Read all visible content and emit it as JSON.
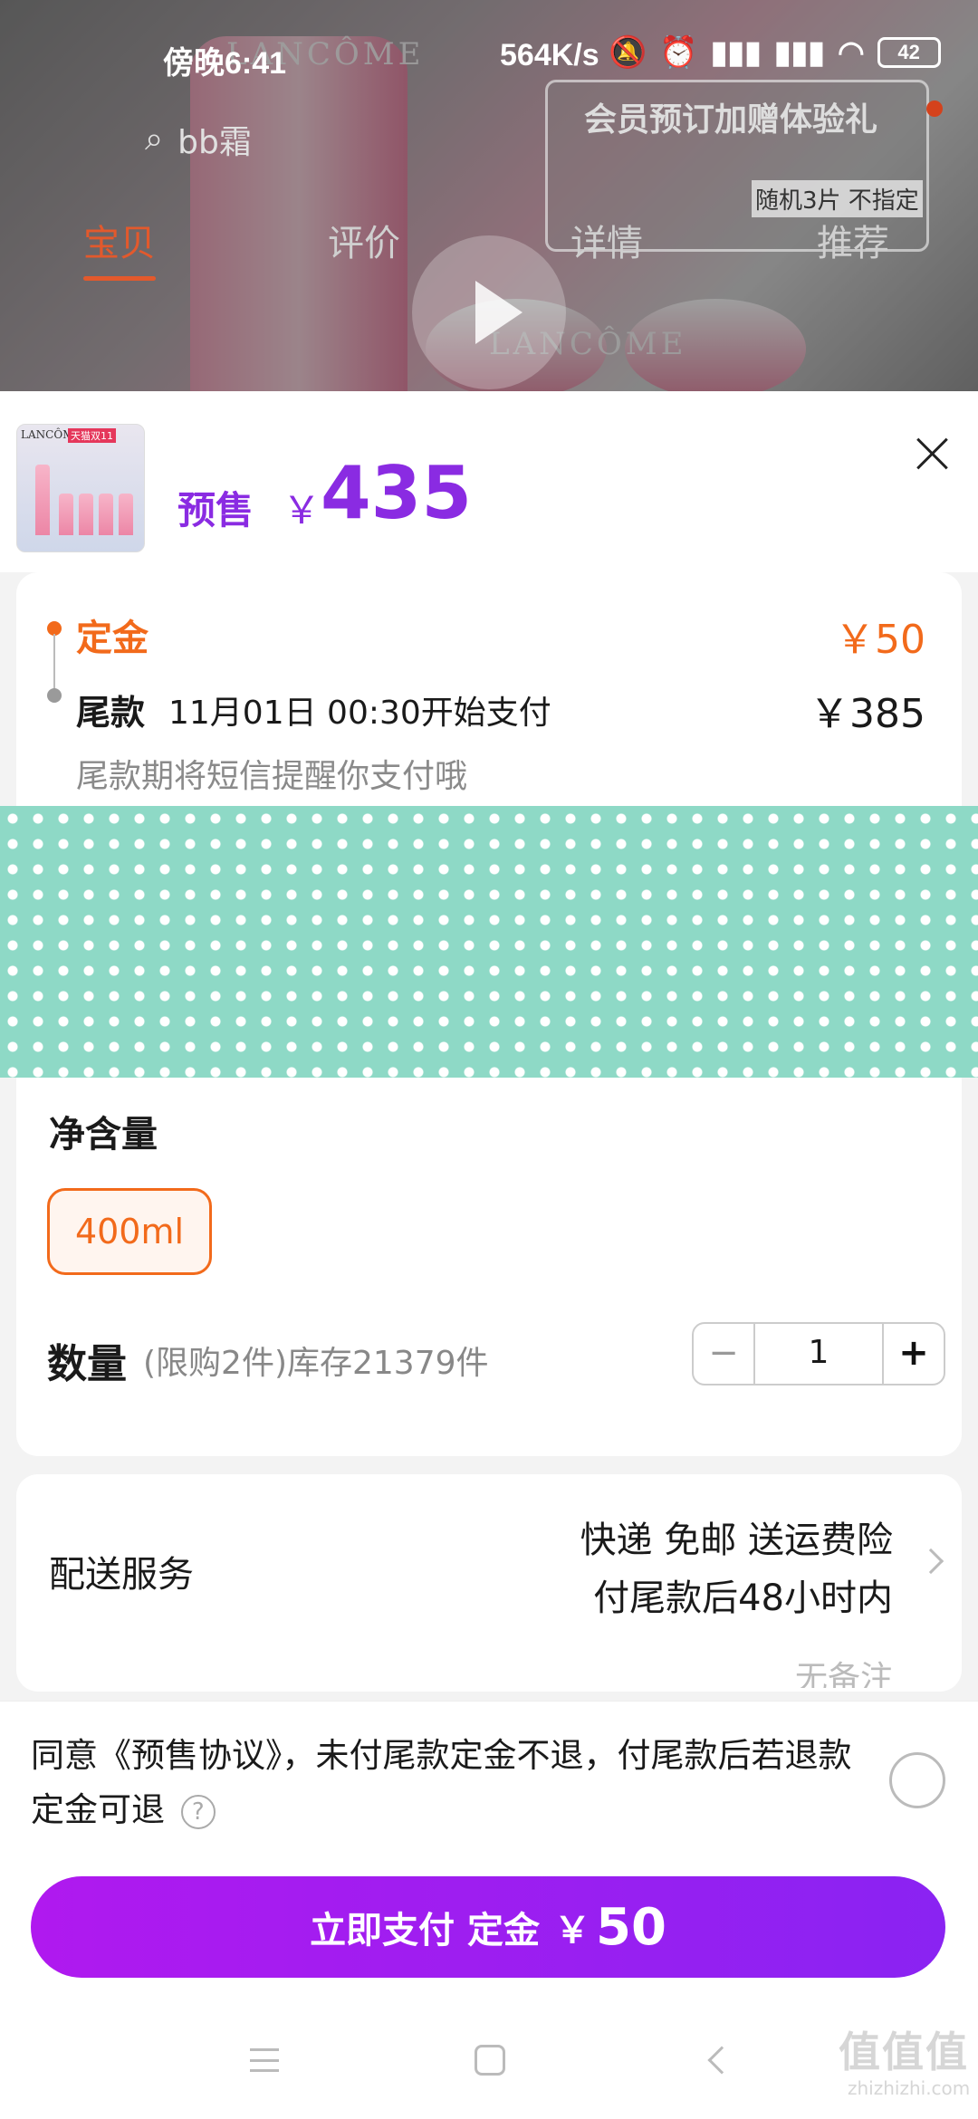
{
  "status_bar": {
    "time": "傍晚6:41",
    "net_rate": "564K/s",
    "battery": "42"
  },
  "background_page": {
    "search_text": "bb霜",
    "brand_watermark": "LANCÔME",
    "promo_title": "会员预订加赠体验礼",
    "promo_sub": "随机3片 不指定",
    "tabs": [
      "宝贝",
      "评价",
      "详情",
      "推荐"
    ]
  },
  "product": {
    "thumb_brand": "LANCÔME",
    "thumb_badge": "天猫双11",
    "presale_label": "预售",
    "currency": "￥",
    "price": "435"
  },
  "payment": {
    "deposit_label": "定金",
    "deposit_amount": "￥50",
    "balance_label": "尾款",
    "balance_time": "11月01日 00:30开始支付",
    "balance_amount": "￥385",
    "sms_note": "尾款期将短信提醒你支付哦"
  },
  "spec": {
    "net_label": "净含量",
    "option": "400ml",
    "qty_label": "数量",
    "qty_hint": "(限购2件)库存21379件",
    "minus": "−",
    "qty_value": "1",
    "plus": "+"
  },
  "shipping": {
    "label": "配送服务",
    "line1": "快递 免邮 送运费险",
    "line2": "付尾款后48小时内",
    "partial": "无备注"
  },
  "agreement": {
    "text": "同意《预售协议》，未付尾款定金不退，付尾款后若退款定金可退",
    "help": "?"
  },
  "pay_button": {
    "label": "立即支付 定金",
    "currency": "￥",
    "amount": "50"
  },
  "watermark": {
    "text": "值值值",
    "sub": "zhizhizhi.com"
  },
  "colors": {
    "accent_purple": "#8a2be2",
    "accent_orange": "#f26a1b",
    "mosaic": "#8ed9c6"
  }
}
